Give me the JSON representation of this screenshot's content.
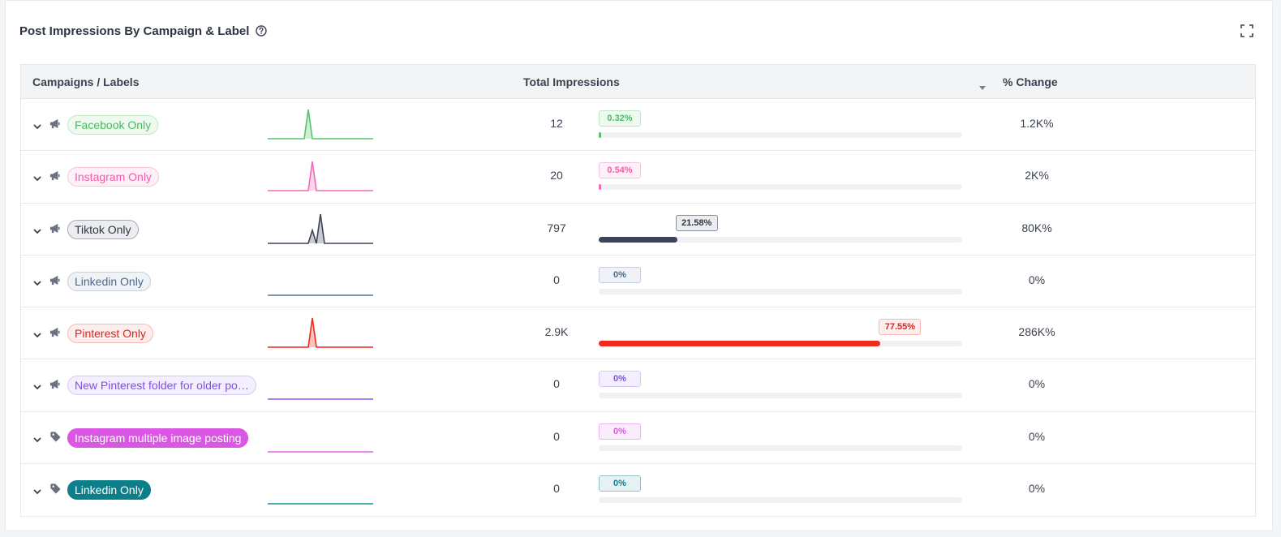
{
  "header": {
    "title": "Post Impressions By Campaign & Label"
  },
  "table": {
    "columns": {
      "campaigns": "Campaigns / Labels",
      "total": "Total Impressions",
      "change": "% Change"
    },
    "rows": [
      {
        "type": "campaign",
        "label": "Facebook Only",
        "total": "12",
        "percent_label": "0.32%",
        "percent": 0.32,
        "change": "1.2K%",
        "color": "#55c36a",
        "pill_bg": "#eefaf0",
        "pill_border": "#bfe8c7",
        "pill_text": "#4cb862",
        "filled": false,
        "spark": [
          0,
          0,
          0,
          0,
          0,
          0,
          0,
          0,
          0,
          0,
          1,
          0,
          0,
          0,
          0,
          0,
          0,
          0,
          0,
          0,
          0,
          0,
          0,
          0,
          0,
          0,
          0
        ]
      },
      {
        "type": "campaign",
        "label": "Instagram Only",
        "total": "20",
        "percent_label": "0.54%",
        "percent": 0.54,
        "change": "2K%",
        "color": "#f26ab5",
        "pill_bg": "#fdf0f7",
        "pill_border": "#f9c4e1",
        "pill_text": "#ef5fad",
        "filled": false,
        "spark": [
          0,
          0,
          0,
          0,
          0,
          0,
          0,
          0,
          0,
          0,
          0,
          1,
          0,
          0,
          0,
          0,
          0,
          0,
          0,
          0,
          0,
          0,
          0,
          0,
          0,
          0,
          0
        ]
      },
      {
        "type": "campaign",
        "label": "Tiktok Only",
        "total": "797",
        "percent_label": "21.58%",
        "percent": 21.58,
        "change": "80K%",
        "color": "#3d4459",
        "pill_bg": "#ecedf1",
        "pill_border": "#a7aab5",
        "pill_text": "#2e3542",
        "filled": false,
        "spark": [
          0,
          0,
          0,
          0,
          0,
          0,
          0,
          0,
          0,
          0,
          0,
          0.45,
          0,
          1,
          0,
          0,
          0,
          0,
          0,
          0,
          0,
          0,
          0,
          0,
          0,
          0,
          0
        ]
      },
      {
        "type": "campaign",
        "label": "Linkedin Only",
        "total": "0",
        "percent_label": "0%",
        "percent": 0,
        "change": "0%",
        "color": "#5a7390",
        "pill_bg": "#eff2f6",
        "pill_border": "#c6d0dc",
        "pill_text": "#4d6887",
        "filled": false,
        "spark": [
          0,
          0,
          0,
          0,
          0,
          0,
          0,
          0,
          0,
          0,
          0,
          0,
          0,
          0,
          0,
          0,
          0,
          0,
          0,
          0,
          0,
          0,
          0,
          0,
          0,
          0,
          0
        ]
      },
      {
        "type": "campaign",
        "label": "Pinterest Only",
        "total": "2.9K",
        "percent_label": "77.55%",
        "percent": 77.55,
        "change": "286K%",
        "color": "#ef2a1e",
        "pill_bg": "#fdeeed",
        "pill_border": "#f6b9b4",
        "pill_text": "#e0241a",
        "filled": false,
        "spark": [
          0,
          0,
          0,
          0,
          0,
          0,
          0,
          0,
          0,
          0,
          0,
          1,
          0,
          0,
          0,
          0,
          0,
          0,
          0,
          0,
          0,
          0,
          0,
          0,
          0,
          0,
          0
        ]
      },
      {
        "type": "campaign",
        "label": "New Pinterest folder for older po…",
        "total": "0",
        "percent_label": "0%",
        "percent": 0,
        "change": "0%",
        "color": "#8b5cf0",
        "pill_bg": "#f4effe",
        "pill_border": "#d8c8fa",
        "pill_text": "#7f4ee8",
        "filled": false,
        "spark": [
          0,
          0,
          0,
          0,
          0,
          0,
          0,
          0,
          0,
          0,
          0,
          0,
          0,
          0,
          0,
          0,
          0,
          0,
          0,
          0,
          0,
          0,
          0,
          0,
          0,
          0,
          0
        ]
      },
      {
        "type": "label",
        "label": "Instagram multiple image posting",
        "total": "0",
        "percent_label": "0%",
        "percent": 0,
        "change": "0%",
        "color": "#e062e8",
        "pill_bg": "#d957e3",
        "pill_border": "#d957e3",
        "pill_text": "#ffffff",
        "filled": true,
        "spark": [
          0,
          0,
          0,
          0,
          0,
          0,
          0,
          0,
          0,
          0,
          0,
          0,
          0,
          0,
          0,
          0,
          0,
          0,
          0,
          0,
          0,
          0,
          0,
          0,
          0,
          0,
          0
        ]
      },
      {
        "type": "label",
        "label": "Linkedin Only",
        "total": "0",
        "percent_label": "0%",
        "percent": 0,
        "change": "0%",
        "color": "#0f8e99",
        "pill_bg": "#0c7f8a",
        "pill_border": "#0c7f8a",
        "pill_text": "#ffffff",
        "filled": true,
        "spark": [
          0,
          0,
          0,
          0,
          0,
          0,
          0,
          0,
          0,
          0,
          0,
          0,
          0,
          0,
          0,
          0,
          0,
          0,
          0,
          0,
          0,
          0,
          0,
          0,
          0,
          0,
          0
        ]
      }
    ]
  },
  "icons": {
    "help": "help-circle-icon",
    "expand": "fullscreen-icon",
    "sort": "caret-down-icon",
    "expand_row": "chevron-down-icon",
    "campaign": "megaphone-icon",
    "label": "tag-icon"
  }
}
